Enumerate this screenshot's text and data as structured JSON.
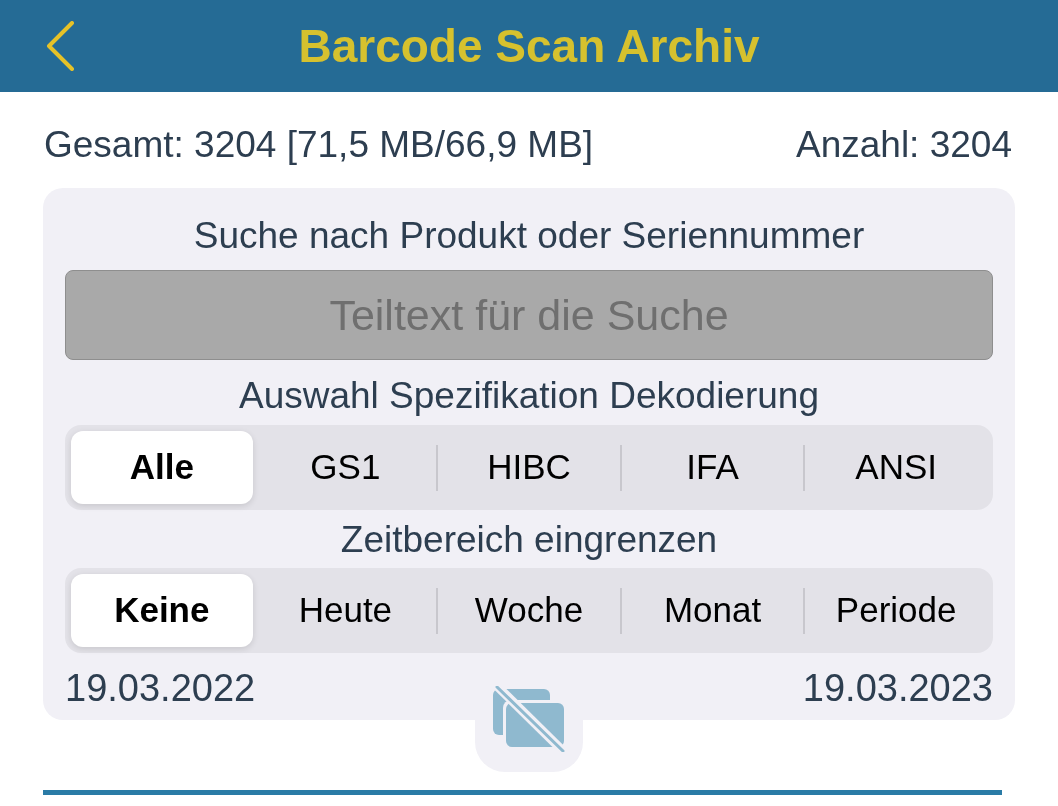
{
  "header": {
    "title": "Barcode Scan Archiv"
  },
  "stats": {
    "total": "Gesamt: 3204 [71,5 MB/66,9 MB]",
    "count": "Anzahl: 3204"
  },
  "search": {
    "label": "Suche nach Produkt oder Seriennummer",
    "placeholder": "Teiltext für die Suche"
  },
  "spec_filter": {
    "label": "Auswahl Spezifikation Dekodierung",
    "options": [
      {
        "label": "Alle",
        "selected": true
      },
      {
        "label": "GS1",
        "selected": false
      },
      {
        "label": "HIBC",
        "selected": false
      },
      {
        "label": "IFA",
        "selected": false
      },
      {
        "label": "ANSI",
        "selected": false
      }
    ]
  },
  "time_filter": {
    "label": "Zeitbereich eingrenzen",
    "options": [
      {
        "label": "Keine",
        "selected": true
      },
      {
        "label": "Heute",
        "selected": false
      },
      {
        "label": "Woche",
        "selected": false
      },
      {
        "label": "Monat",
        "selected": false
      },
      {
        "label": "Periode",
        "selected": false
      }
    ]
  },
  "date_range": {
    "start": "19.03.2022",
    "end": "19.03.2023"
  }
}
